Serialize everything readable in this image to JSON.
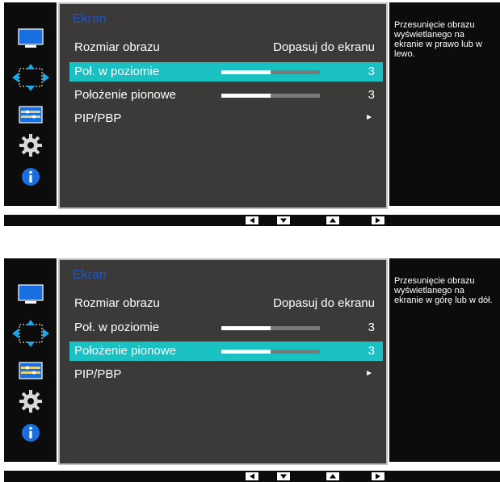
{
  "screens": [
    {
      "section_title": "Ekran",
      "description": "Przesunięcie obrazu wyświetlanego na ekranie w prawo lub w lewo.",
      "menu": {
        "rozmiar_label": "Rozmiar obrazu",
        "rozmiar_value": "Dopasuj do ekranu",
        "poziom_label": "Poł. w poziomie",
        "poziom_value": "3",
        "pion_label": "Położenie pionowe",
        "pion_value": "3",
        "pip_label": "PIP/PBP",
        "pip_arrow": "►"
      },
      "selected_item": "Poł. w poziomie",
      "slider_fill_fraction": 0.5
    },
    {
      "section_title": "Ekran",
      "description": "Przesunięcie obrazu wyświetlanego na ekranie w górę lub w dół.",
      "menu": {
        "rozmiar_label": "Rozmiar obrazu",
        "rozmiar_value": "Dopasuj do ekranu",
        "poziom_label": "Poł. w poziomie",
        "poziom_value": "3",
        "pion_label": "Położenie pionowe",
        "pion_value": "3",
        "pip_label": "PIP/PBP",
        "pip_arrow": "►"
      },
      "selected_item": "Położenie pionowe",
      "slider_fill_fraction": 0.5
    }
  ],
  "sidebar_icons": [
    "monitor-icon",
    "position-arrows-icon",
    "picture-settings-icon",
    "gear-icon",
    "info-icon"
  ],
  "nav_buttons": [
    "left-arrow-icon",
    "down-arrow-icon",
    "up-arrow-icon",
    "right-arrow-icon"
  ],
  "colors": {
    "accent_cyan": "#19c1c3",
    "section_title_blue": "#1e54c6",
    "panel_bg": "#3b3a38",
    "sidebar_bg": "#0c0c0c"
  }
}
